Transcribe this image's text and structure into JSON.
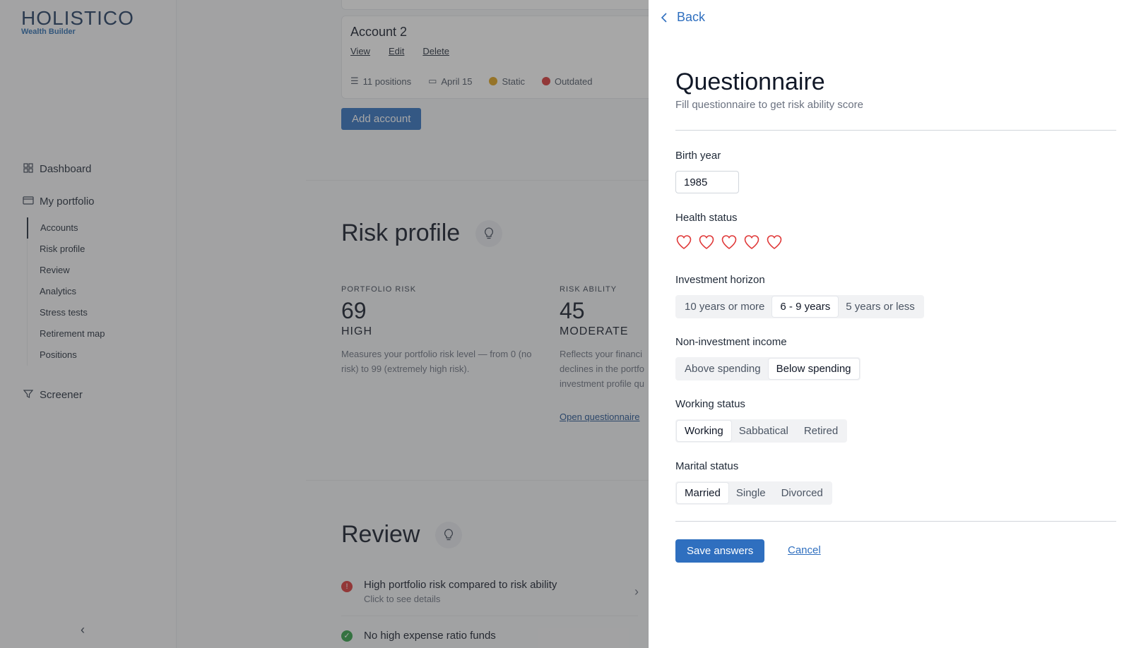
{
  "brand": {
    "name": "HOLISTICO",
    "tagline": "Wealth Builder"
  },
  "sidebar": {
    "items": [
      {
        "label": "Dashboard",
        "icon": "grid-icon"
      },
      {
        "label": "My portfolio",
        "icon": "wallet-icon"
      }
    ],
    "portfolio_sub": [
      "Accounts",
      "Risk profile",
      "Review",
      "Analytics",
      "Stress tests",
      "Retirement map",
      "Positions"
    ],
    "screener": "Screener",
    "collapse": "‹"
  },
  "account": {
    "title": "Account 2",
    "actions": [
      "View",
      "Edit",
      "Delete"
    ],
    "positions": "11 positions",
    "date": "April 15",
    "status1": "Static",
    "status2": "Outdated",
    "colors": {
      "static": "#e0a21b",
      "outdated": "#d93636"
    }
  },
  "add_account": "Add account",
  "risk_profile": {
    "title": "Risk profile",
    "portfolio_risk": {
      "label": "PORTFOLIO RISK",
      "value": "69",
      "level": "HIGH",
      "desc": "Measures your portfolio risk level — from 0 (no risk) to 99 (extremely high risk)."
    },
    "risk_ability": {
      "label": "RISK ABILITY",
      "value": "45",
      "level": "MODERATE",
      "desc": "Reflects your financi declines in the portfo investment profile qu"
    },
    "open_questionnaire": "Open questionnaire"
  },
  "review": {
    "title": "Review",
    "items": [
      {
        "title": "High portfolio risk compared to risk ability",
        "sub": "Click to see details",
        "status": "error"
      },
      {
        "title": "No high expense ratio funds",
        "sub": "",
        "status": "ok"
      }
    ]
  },
  "panel": {
    "back": "Back",
    "title": "Questionnaire",
    "subtitle": "Fill questionnaire to get risk ability score",
    "birth_year": {
      "label": "Birth year",
      "value": "1985"
    },
    "health": {
      "label": "Health status",
      "rating": 0,
      "max": 5,
      "color": "#e03a3a"
    },
    "horizon": {
      "label": "Investment horizon",
      "options": [
        "10 years or more",
        "6 - 9 years",
        "5 years or less"
      ],
      "selected": 1
    },
    "income": {
      "label": "Non-investment income",
      "options": [
        "Above spending",
        "Below spending"
      ],
      "selected": 1
    },
    "working": {
      "label": "Working status",
      "options": [
        "Working",
        "Sabbatical",
        "Retired"
      ],
      "selected": 0
    },
    "marital": {
      "label": "Marital status",
      "options": [
        "Married",
        "Single",
        "Divorced"
      ],
      "selected": 0
    },
    "save": "Save answers",
    "cancel": "Cancel"
  }
}
